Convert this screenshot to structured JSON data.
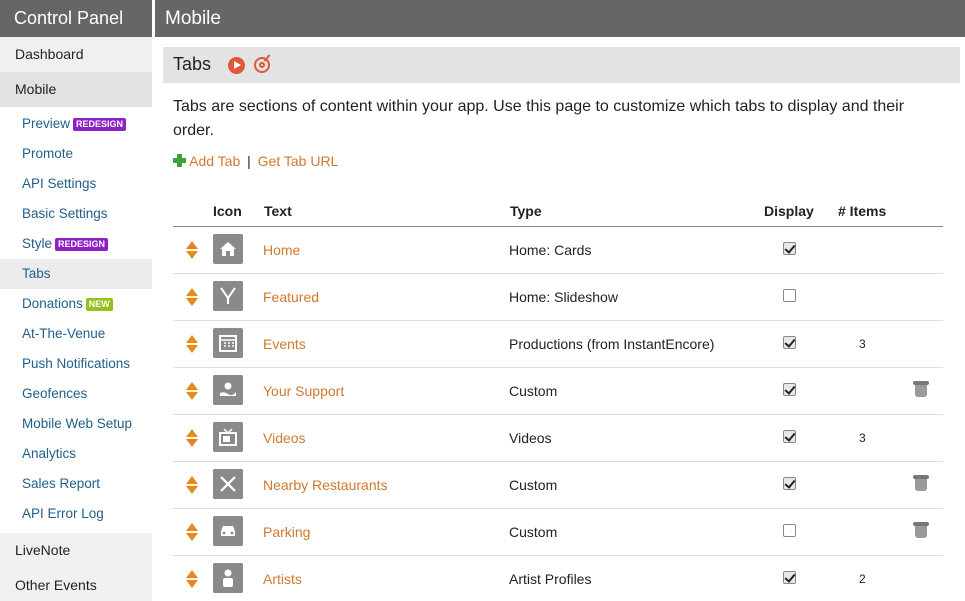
{
  "sidebar": {
    "title": "Control Panel",
    "top_items": [
      {
        "label": "Dashboard"
      },
      {
        "label": "Mobile"
      }
    ],
    "sub_items": [
      {
        "label": "Preview",
        "badge": "REDESIGN"
      },
      {
        "label": "Promote"
      },
      {
        "label": "API Settings"
      },
      {
        "label": "Basic Settings"
      },
      {
        "label": "Style",
        "badge": "REDESIGN"
      },
      {
        "label": "Tabs"
      },
      {
        "label": "Donations",
        "badge": "NEW"
      },
      {
        "label": "At-The-Venue"
      },
      {
        "label": "Push Notifications"
      },
      {
        "label": "Geofences"
      },
      {
        "label": "Mobile Web Setup"
      },
      {
        "label": "Analytics"
      },
      {
        "label": "Sales Report"
      },
      {
        "label": "API Error Log"
      }
    ],
    "bottom_items": [
      {
        "label": "LiveNote"
      },
      {
        "label": "Other Events"
      }
    ]
  },
  "header": {
    "title": "Mobile"
  },
  "section": {
    "title": "Tabs",
    "description": "Tabs are sections of content within your app. Use this page to customize which tabs to display and their order.",
    "add_tab": "Add Tab",
    "separator": "|",
    "get_url": "Get Tab URL"
  },
  "table": {
    "headers": {
      "icon": "Icon",
      "text": "Text",
      "type": "Type",
      "display": "Display",
      "items": "# Items"
    },
    "rows": [
      {
        "icon": "home-icon",
        "text": "Home",
        "type": "Home: Cards",
        "display": true,
        "items": ""
      },
      {
        "icon": "featured-icon",
        "text": "Featured",
        "type": "Home: Slideshow",
        "display": false,
        "items": ""
      },
      {
        "icon": "calendar-icon",
        "text": "Events",
        "type": "Productions (from InstantEncore)",
        "display": true,
        "items": "3"
      },
      {
        "icon": "support-icon",
        "text": "Your Support",
        "type": "Custom",
        "display": true,
        "items": "",
        "deletable": true
      },
      {
        "icon": "tv-icon",
        "text": "Videos",
        "type": "Videos",
        "display": true,
        "items": "3"
      },
      {
        "icon": "utensils-icon",
        "text": "Nearby Restaurants",
        "type": "Custom",
        "display": true,
        "items": "",
        "deletable": true
      },
      {
        "icon": "car-icon",
        "text": "Parking",
        "type": "Custom",
        "display": false,
        "items": "",
        "deletable": true
      },
      {
        "icon": "person-icon",
        "text": "Artists",
        "type": "Artist Profiles",
        "display": true,
        "items": "2"
      }
    ]
  },
  "colors": {
    "accent": "#d07a2e",
    "nav_link": "#1f5f8b",
    "header_bg": "#666666",
    "badge_purple": "#8f1fc7",
    "badge_green": "#94c11f"
  }
}
